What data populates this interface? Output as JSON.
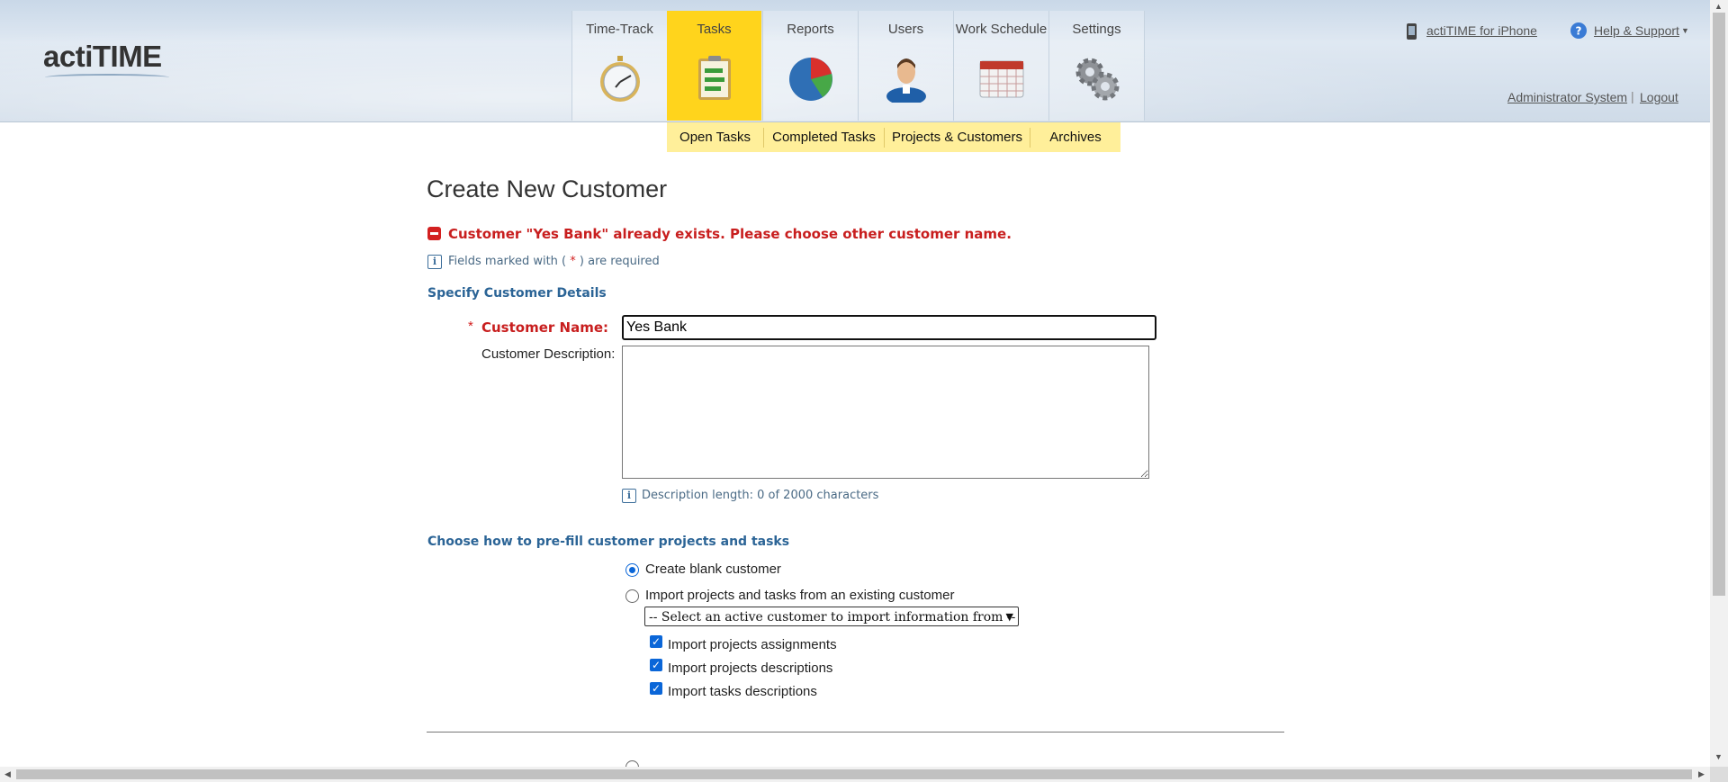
{
  "app": {
    "logo_text": "actiTIME"
  },
  "nav": {
    "tabs": [
      {
        "label": "Time-Track",
        "icon": "stopwatch-icon"
      },
      {
        "label": "Tasks",
        "icon": "task-list-icon",
        "active": true
      },
      {
        "label": "Reports",
        "icon": "pie-chart-icon"
      },
      {
        "label": "Users",
        "icon": "user-icon"
      },
      {
        "label": "Work Schedule",
        "icon": "calendar-icon"
      },
      {
        "label": "Settings",
        "icon": "gears-icon"
      }
    ],
    "sub": [
      "Open Tasks",
      "Completed Tasks",
      "Projects & Customers",
      "Archives"
    ]
  },
  "header_links": {
    "iphone": "actiTIME for iPhone",
    "help": "Help & Support",
    "user": "Administrator System",
    "logout": "Logout"
  },
  "page": {
    "title": "Create New Customer",
    "error": "Customer \"Yes Bank\" already exists. Please choose other customer name.",
    "required_note_before": "Fields marked with (",
    "required_star": "*",
    "required_note_after": ") are required",
    "section_details": "Specify Customer Details",
    "name_label": "Customer Name:",
    "name_value": "Yes Bank",
    "desc_label": "Customer Description:",
    "desc_length": "Description length: 0 of 2000 characters",
    "section_prefill": "Choose how to pre-fill customer projects and tasks",
    "opt_blank": "Create blank customer",
    "opt_import": "Import projects and tasks from an existing customer",
    "select_placeholder": "-- Select an active customer to import information from --",
    "chk_assignments": "Import projects assignments",
    "chk_proj_desc": "Import projects descriptions",
    "chk_task_desc": "Import tasks descriptions"
  },
  "colors": {
    "accent_yellow": "#ffd41c",
    "subnav_yellow": "#ffef9a",
    "error_red": "#c81e1e",
    "section_blue": "#2b6496"
  }
}
